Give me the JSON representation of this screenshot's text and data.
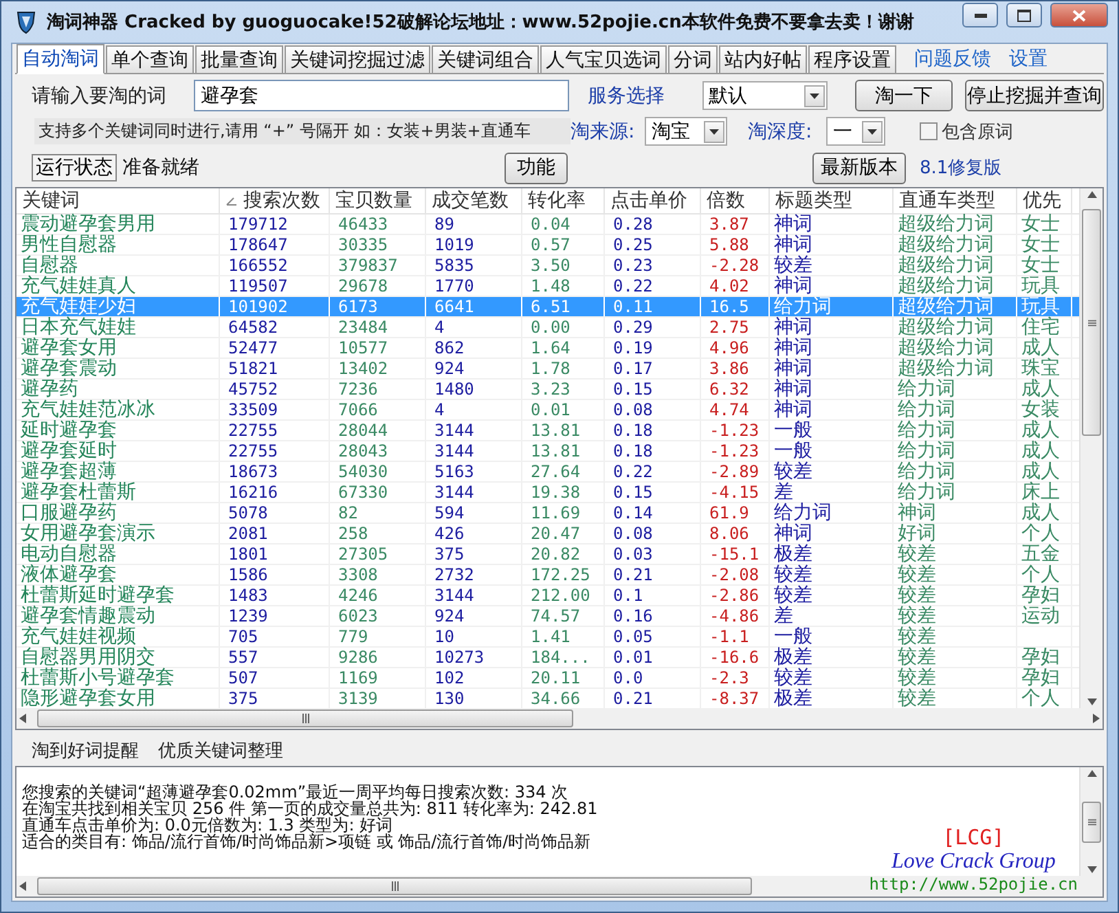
{
  "window": {
    "title": "淘词神器 Cracked by guoguocake!52破解论坛地址：www.52pojie.cn本软件免费不要拿去卖！谢谢"
  },
  "tabs": [
    {
      "label": "自动淘词",
      "selected": true
    },
    {
      "label": "单个查询",
      "selected": false
    },
    {
      "label": "批量查询",
      "selected": false
    },
    {
      "label": "关键词挖掘过滤",
      "selected": false
    },
    {
      "label": "关键词组合",
      "selected": false
    },
    {
      "label": "人气宝贝选词",
      "selected": false
    },
    {
      "label": "分词",
      "selected": false
    },
    {
      "label": "站内好帖",
      "selected": false
    },
    {
      "label": "程序设置",
      "selected": false
    }
  ],
  "links": [
    "问题反馈",
    "设置"
  ],
  "query": {
    "label": "请输入要淘的词",
    "value": "避孕套",
    "hint": "支持多个关键词同时进行,请用 “+” 号隔开  如：女装+男装+直通车"
  },
  "service": {
    "label": "服务选择",
    "value": "默认"
  },
  "buttons": {
    "search": "淘一下",
    "stop": "停止挖掘并查询",
    "function": "功能",
    "latest": "最新版本"
  },
  "source": {
    "label": "淘来源:",
    "value": "淘宝"
  },
  "depth": {
    "label": "淘深度:",
    "value": "一"
  },
  "include_original": {
    "label": "包含原词",
    "checked": false
  },
  "status": {
    "label": "运行状态",
    "text": "准备就绪"
  },
  "version": "8.1修复版",
  "table": {
    "columns": [
      {
        "label": "关键词",
        "color": "#24855a",
        "sorted": false
      },
      {
        "label": "搜索次数",
        "color": "#1c1ca0",
        "sorted": true
      },
      {
        "label": "宝贝数量",
        "color": "#3a8a64",
        "sorted": false
      },
      {
        "label": "成交笔数",
        "color": "#1c1ca0",
        "sorted": false
      },
      {
        "label": "转化率",
        "color": "#3a8a64",
        "sorted": false
      },
      {
        "label": "点击单价",
        "color": "#1c1ca0",
        "sorted": false
      },
      {
        "label": "倍数",
        "color": "#c81e1e",
        "sorted": false
      },
      {
        "label": "标题类型",
        "color": "#1c1ca0",
        "sorted": false
      },
      {
        "label": "直通车类型",
        "color": "#3a8a64",
        "sorted": false
      },
      {
        "label": "优先",
        "color": "#3a8a64",
        "sorted": false
      }
    ],
    "rows": [
      {
        "selected": false,
        "cells": [
          "震动避孕套男用",
          "179712",
          "46433",
          "89",
          "0.04",
          "0.28",
          "3.87",
          "神词",
          "超级给力词",
          "女士"
        ]
      },
      {
        "selected": false,
        "cells": [
          "男性自慰器",
          "178647",
          "30335",
          "1019",
          "0.57",
          "0.25",
          "5.88",
          "神词",
          "超级给力词",
          "女士"
        ]
      },
      {
        "selected": false,
        "cells": [
          "自慰器",
          "166552",
          "379837",
          "5835",
          "3.50",
          "0.23",
          "-2.28",
          "较差",
          "超级给力词",
          "女士"
        ]
      },
      {
        "selected": false,
        "cells": [
          "充气娃娃真人",
          "119507",
          "29678",
          "1770",
          "1.48",
          "0.22",
          "4.02",
          "神词",
          "超级给力词",
          "玩具"
        ]
      },
      {
        "selected": true,
        "cells": [
          "充气娃娃少妇",
          "101902",
          "6173",
          "6641",
          "6.51",
          "0.11",
          "16.5",
          "给力词",
          "超级给力词",
          "玩具"
        ]
      },
      {
        "selected": false,
        "cells": [
          "日本充气娃娃",
          "64582",
          "23484",
          "4",
          "0.00",
          "0.29",
          "2.75",
          "神词",
          "超级给力词",
          "住宅"
        ]
      },
      {
        "selected": false,
        "cells": [
          "避孕套女用",
          "52477",
          "10577",
          "862",
          "1.64",
          "0.19",
          "4.96",
          "神词",
          "超级给力词",
          "成人"
        ]
      },
      {
        "selected": false,
        "cells": [
          "避孕套震动",
          "51821",
          "13402",
          "924",
          "1.78",
          "0.17",
          "3.86",
          "神词",
          "超级给力词",
          "珠宝"
        ]
      },
      {
        "selected": false,
        "cells": [
          "避孕药",
          "45752",
          "7236",
          "1480",
          "3.23",
          "0.15",
          "6.32",
          "神词",
          "给力词",
          "成人"
        ]
      },
      {
        "selected": false,
        "cells": [
          "充气娃娃范冰冰",
          "33509",
          "7066",
          "4",
          "0.01",
          "0.08",
          "4.74",
          "神词",
          "给力词",
          "女装"
        ]
      },
      {
        "selected": false,
        "cells": [
          "延时避孕套",
          "22755",
          "28044",
          "3144",
          "13.81",
          "0.18",
          "-1.23",
          "一般",
          "给力词",
          "成人"
        ]
      },
      {
        "selected": false,
        "cells": [
          "避孕套延时",
          "22755",
          "28043",
          "3144",
          "13.81",
          "0.18",
          "-1.23",
          "一般",
          "给力词",
          "成人"
        ]
      },
      {
        "selected": false,
        "cells": [
          "避孕套超薄",
          "18673",
          "54030",
          "5163",
          "27.64",
          "0.22",
          "-2.89",
          "较差",
          "给力词",
          "成人"
        ]
      },
      {
        "selected": false,
        "cells": [
          "避孕套杜蕾斯",
          "16216",
          "67330",
          "3144",
          "19.38",
          "0.15",
          "-4.15",
          "差",
          "给力词",
          "床上"
        ]
      },
      {
        "selected": false,
        "cells": [
          "口服避孕药",
          "5078",
          "82",
          "594",
          "11.69",
          "0.14",
          "61.9",
          "给力词",
          "神词",
          "成人"
        ]
      },
      {
        "selected": false,
        "cells": [
          "女用避孕套演示",
          "2081",
          "258",
          "426",
          "20.47",
          "0.08",
          "8.06",
          "神词",
          "好词",
          "个人"
        ]
      },
      {
        "selected": false,
        "cells": [
          "电动自慰器",
          "1801",
          "27305",
          "375",
          "20.82",
          "0.03",
          "-15.1",
          "极差",
          "较差",
          "五金"
        ]
      },
      {
        "selected": false,
        "cells": [
          "液体避孕套",
          "1586",
          "3308",
          "2732",
          "172.25",
          "0.21",
          "-2.08",
          "较差",
          "较差",
          "个人"
        ]
      },
      {
        "selected": false,
        "cells": [
          "杜蕾斯延时避孕套",
          "1483",
          "4246",
          "3144",
          "212.00",
          "0.1",
          "-2.86",
          "较差",
          "较差",
          "孕妇"
        ]
      },
      {
        "selected": false,
        "cells": [
          "避孕套情趣震动",
          "1239",
          "6023",
          "924",
          "74.57",
          "0.16",
          "-4.86",
          "差",
          "较差",
          "运动"
        ]
      },
      {
        "selected": false,
        "cells": [
          "充气娃娃视频",
          "705",
          "779",
          "10",
          "1.41",
          "0.05",
          "-1.1",
          "一般",
          "较差",
          ""
        ]
      },
      {
        "selected": false,
        "cells": [
          "自慰器男用阴交",
          "557",
          "9286",
          "10273",
          "184...",
          "0.01",
          "-16.6",
          "极差",
          "较差",
          "孕妇"
        ]
      },
      {
        "selected": false,
        "cells": [
          "杜蕾斯小号避孕套",
          "507",
          "1169",
          "102",
          "20.11",
          "0.0",
          "-2.3",
          "较差",
          "较差",
          "孕妇"
        ]
      },
      {
        "selected": false,
        "cells": [
          "隐形避孕套女用",
          "375",
          "3139",
          "130",
          "34.66",
          "0.21",
          "-8.37",
          "极差",
          "较差",
          "个人"
        ]
      }
    ]
  },
  "bottom_tabs": [
    {
      "label": "淘到好词提醒",
      "selected": false
    },
    {
      "label": "优质关键词整理",
      "selected": false
    }
  ],
  "log": [
    "您搜索的关键词“超薄避孕套0.02mm”最近一周平均每日搜索次数:  334 次",
    "在淘宝共找到相关宝贝 256 件  第一页的成交量总共为: 811 转化率为: 242.81",
    "直通车点击单价为:  0.0元倍数为: 1.3  类型为: 好词",
    "适合的类目有:  饰品/流行首饰/时尚饰品新>项链  或  饰品/流行首饰/时尚饰品新"
  ],
  "logo": {
    "tag": "[LCG]",
    "name": "Love Crack Group",
    "url": "http://www.52pojie.cn"
  }
}
